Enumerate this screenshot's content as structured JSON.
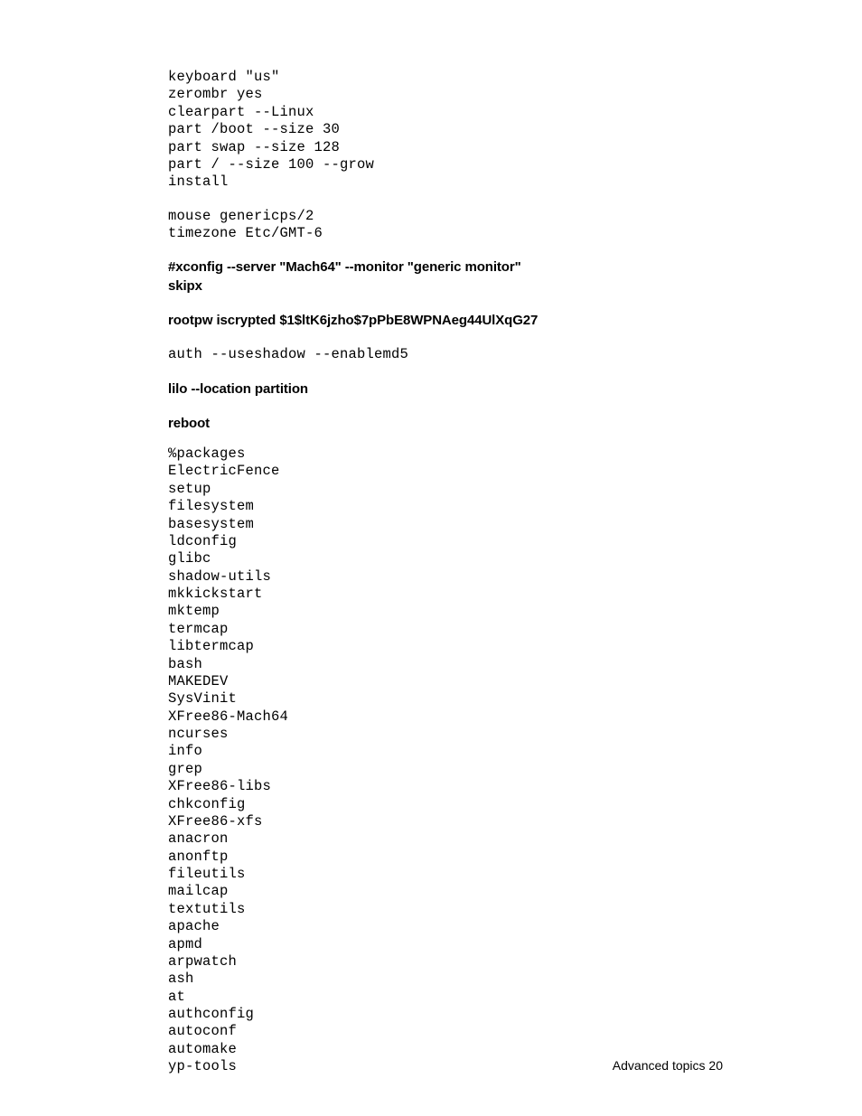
{
  "block1": "keyboard \"us\"\nzerombr yes\nclearpart --Linux\npart /boot --size 30\npart swap --size 128\npart / --size 100 --grow\ninstall",
  "block2": "mouse genericps/2\ntimezone Etc/GMT-6",
  "bold1": "#xconfig --server \"Mach64\" --monitor \"generic monitor\"\nskipx",
  "bold2": "rootpw iscrypted $1$ltK6jzho$7pPbE8WPNAeg44UlXqG27",
  "block3": "auth --useshadow --enablemd5",
  "bold3": "lilo --location partition",
  "bold4": "reboot",
  "block4": "%packages\nElectricFence\nsetup\nfilesystem\nbasesystem\nldconfig\nglibc\nshadow-utils\nmkkickstart\nmktemp\ntermcap\nlibtermcap\nbash\nMAKEDEV\nSysVinit\nXFree86-Mach64\nncurses\ninfo\ngrep\nXFree86-libs\nchkconfig\nXFree86-xfs\nanacron\nanonftp\nfileutils\nmailcap\ntextutils\napache\napmd\narpwatch\nash\nat\nauthconfig\nautoconf\nautomake\nyp-tools",
  "footer": "Advanced topics   20"
}
